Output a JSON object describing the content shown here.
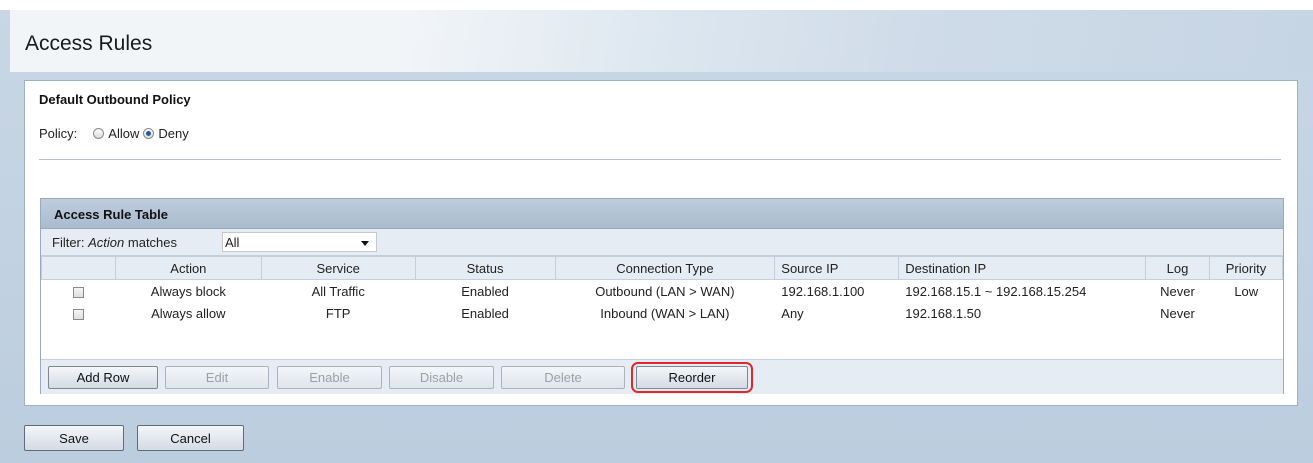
{
  "page": {
    "title": "Access Rules"
  },
  "outbound_policy": {
    "section_title": "Default Outbound Policy",
    "policy_label": "Policy:",
    "options": [
      {
        "label": "Allow",
        "checked": false
      },
      {
        "label": "Deny",
        "checked": true
      }
    ]
  },
  "rule_table": {
    "title": "Access Rule Table",
    "filter": {
      "prefix": "Filter:",
      "field": "Action",
      "matches": "matches",
      "selected": "All"
    },
    "columns": [
      "",
      "Action",
      "Service",
      "Status",
      "Connection Type",
      "Source IP",
      "Destination IP",
      "Log",
      "Priority"
    ],
    "rows": [
      {
        "action": "Always block",
        "service": "All Traffic",
        "status": "Enabled",
        "connection": "Outbound (LAN > WAN)",
        "source": "192.168.1.100",
        "destination": "192.168.15.1 ~ 192.168.15.254",
        "log": "Never",
        "priority": "Low"
      },
      {
        "action": "Always allow",
        "service": "FTP",
        "status": "Enabled",
        "connection": "Inbound (WAN > LAN)",
        "source": "Any",
        "destination": "192.168.1.50",
        "log": "Never",
        "priority": ""
      }
    ],
    "buttons": {
      "add_row": "Add Row",
      "edit": "Edit",
      "enable": "Enable",
      "disable": "Disable",
      "delete": "Delete",
      "reorder": "Reorder"
    }
  },
  "footer": {
    "save": "Save",
    "cancel": "Cancel"
  },
  "colors": {
    "highlight": "#e0282a",
    "header_bar": "#a9bbcf",
    "radio_dot": "#1e5ba8"
  }
}
